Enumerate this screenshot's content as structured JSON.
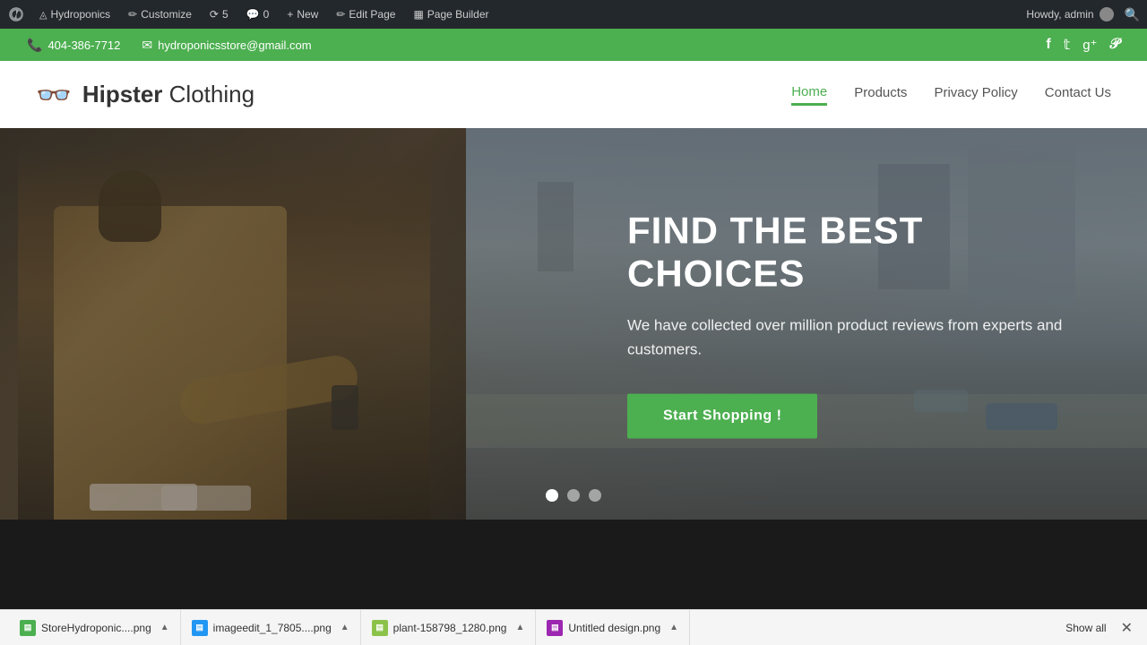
{
  "adminBar": {
    "logo": "W",
    "site": "Hydroponics",
    "customize": "Customize",
    "updates_count": "5",
    "comments_count": "0",
    "new_label": "New",
    "edit_page_label": "Edit Page",
    "page_builder_label": "Page Builder",
    "howdy": "Howdy, admin"
  },
  "contactBar": {
    "phone_icon": "📞",
    "phone": "404-386-7712",
    "email_icon": "✉",
    "email": "hydroponicsstore@gmail.com",
    "social": {
      "facebook": "f",
      "twitter": "t",
      "googleplus": "g+",
      "pinterest": "p"
    }
  },
  "header": {
    "logo_text_bold": "Hipster",
    "logo_text_light": " Clothing",
    "nav": [
      {
        "label": "Home",
        "active": true
      },
      {
        "label": "Products",
        "active": false
      },
      {
        "label": "Privacy Policy",
        "active": false
      },
      {
        "label": "Contact Us",
        "active": false
      }
    ]
  },
  "hero": {
    "title": "FIND THE BEST CHOICES",
    "subtitle": "We have collected over million product reviews from experts and customers.",
    "cta_label": "Start Shopping !",
    "dots": [
      true,
      false,
      false
    ]
  },
  "downloads": {
    "items": [
      {
        "icon_type": "png",
        "name": "StoreHydroponic....png"
      },
      {
        "icon_type": "img",
        "name": "imageedit_1_7805....png"
      },
      {
        "icon_type": "plant",
        "name": "plant-158798_1280.png"
      },
      {
        "icon_type": "design",
        "name": "Untitled design.png"
      }
    ],
    "show_all": "Show all",
    "close": "✕"
  }
}
